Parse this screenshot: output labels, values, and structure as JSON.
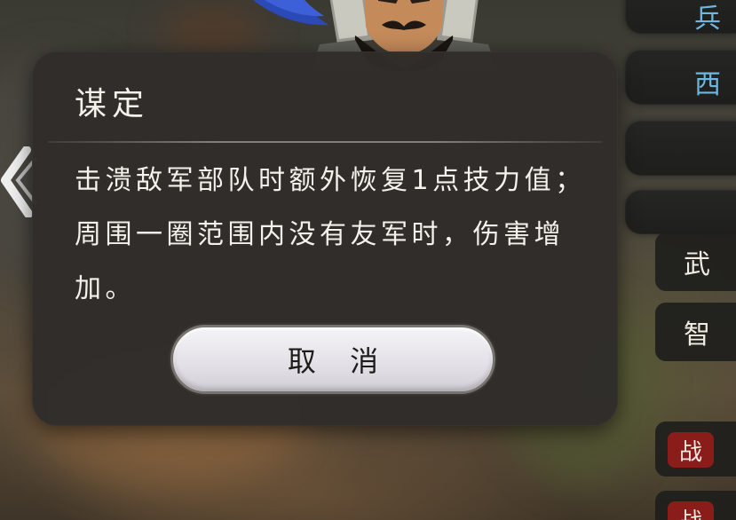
{
  "dialog": {
    "title": "谋定",
    "description": "击溃敌军部队时额外恢复1点技力值；周围一圈范围内没有友军时，伤害增加。",
    "cancel_label": "取 消"
  },
  "side_panel": {
    "tabs": [
      {
        "label": "兵",
        "color": "#6fb7e0"
      },
      {
        "label": "西",
        "color": "#6fb7e0"
      },
      {
        "label": "",
        "color": "#d8a640"
      },
      {
        "label": "",
        "color": "#d8a640"
      }
    ],
    "stats": [
      {
        "label": "武"
      },
      {
        "label": "智"
      }
    ],
    "battle": [
      {
        "badge": "战"
      },
      {
        "badge": "战"
      }
    ]
  },
  "icons": {
    "back": "chevron-left-icon",
    "portrait": "general-portrait"
  },
  "colors": {
    "dialog_bg": "#2f2c2a",
    "text": "#f4f1ea",
    "button_bg": "#e4e2e8",
    "badge_red": "#8a1d1a",
    "tab_blue": "#6fb7e0"
  }
}
